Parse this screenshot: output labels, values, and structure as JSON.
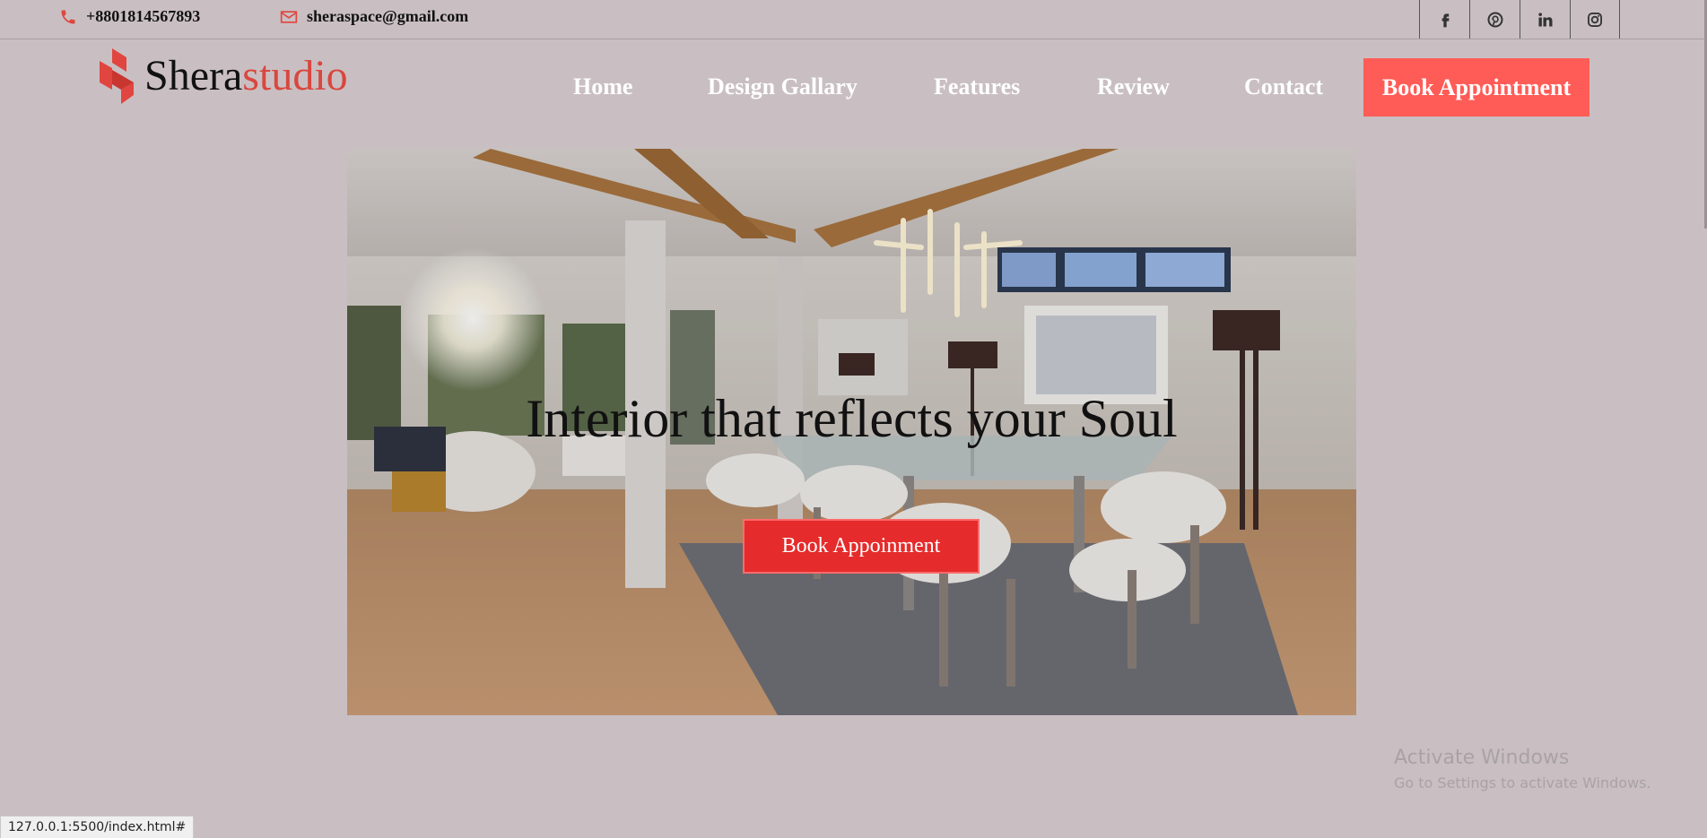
{
  "topbar": {
    "phone": "+8801814567893",
    "email": "sheraspace@gmail.com",
    "socials": [
      {
        "icon": "facebook-icon"
      },
      {
        "icon": "pinterest-icon"
      },
      {
        "icon": "linkedin-icon"
      },
      {
        "icon": "instagram-icon"
      }
    ]
  },
  "brand": {
    "name_primary": "Shera",
    "name_accent": "studio",
    "accent_color": "#d9473e"
  },
  "nav": {
    "items": [
      "Home",
      "Design Gallary",
      "Features",
      "Review",
      "Contact"
    ],
    "cta": "Book Appointment",
    "cta_color": "#ff5c57"
  },
  "hero": {
    "title": "Interior that reflects your Soul",
    "button": "Book Appoinment",
    "button_color": "#e52b2b"
  },
  "watermark": {
    "line1": "Activate Windows",
    "line2": "Go to Settings to activate Windows."
  },
  "statusbar": {
    "url": "127.0.0.1:5500/index.html#"
  }
}
